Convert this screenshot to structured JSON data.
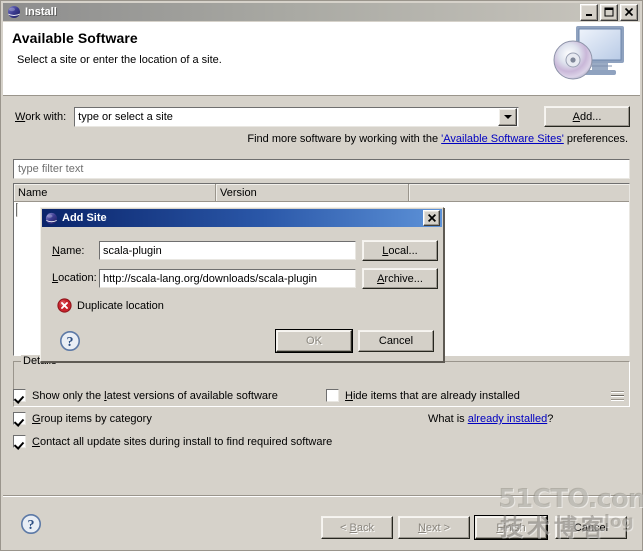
{
  "window": {
    "title": "Install",
    "icon": "eclipse-globe-icon",
    "controls": {
      "minimize": "minimize-icon",
      "maximize": "maximize-icon",
      "close": "close-icon"
    }
  },
  "banner": {
    "title": "Available Software",
    "subtitle": "Select a site or enter the location of a site.",
    "art": "computer-cd-icon"
  },
  "work_with": {
    "label_pre": "W",
    "label_post": "ork with:",
    "combo_value": "type or select a site",
    "dropdown_icon": "chevron-down-icon",
    "add_button": "Add..."
  },
  "hint": {
    "before": "Find more software by working with the ",
    "link": "'Available Software Sites'",
    "after": " preferences."
  },
  "filter": {
    "placeholder": "type filter text"
  },
  "table": {
    "columns": [
      "Name",
      "Version"
    ]
  },
  "details": {
    "label": "Details",
    "resize_grip": "resize-grip-icon"
  },
  "options": [
    {
      "label_pre": "Show only the ",
      "mnemonic": "l",
      "label_post": "atest versions of available software",
      "checked": true
    },
    {
      "label_pre": "",
      "mnemonic": "G",
      "label_post": "roup items by category",
      "checked": true
    },
    {
      "label_pre": "",
      "mnemonic": "C",
      "label_post": "ontact all update sites during install to find required software",
      "checked": true
    },
    {
      "label_pre": "",
      "mnemonic": "H",
      "label_post": "ide items that are already installed",
      "checked": false
    }
  ],
  "what_is": {
    "before": "What is ",
    "link": "already installed",
    "after": "?"
  },
  "footer": {
    "help_icon": "help-question-icon",
    "buttons": [
      {
        "label": "< Back",
        "mnemonic": "B",
        "disabled": true
      },
      {
        "label": "Next >",
        "mnemonic": "N",
        "disabled": true
      },
      {
        "label": "Finish",
        "mnemonic": "F",
        "disabled": true,
        "default": true
      },
      {
        "label": "Cancel",
        "mnemonic": "",
        "disabled": false
      }
    ]
  },
  "dialog": {
    "title": "Add Site",
    "icon": "eclipse-globe-icon",
    "close_icon": "close-icon",
    "name_label_pre": "N",
    "name_label_post": "ame:",
    "name_value": "scala-plugin",
    "location_label_pre": "L",
    "location_label_post": "ocation:",
    "location_value": "http://scala-lang.org/downloads/scala-plugin",
    "local_button": "Local...",
    "archive_button": "Archive...",
    "error_icon": "error-circle-icon",
    "error_text": "Duplicate location",
    "help_icon": "help-question-icon",
    "ok_button": "OK",
    "cancel_button": "Cancel"
  },
  "watermark": {
    "top": "51CTO.com",
    "cn": "技术博客",
    "log": "log"
  },
  "colors": {
    "face": "#d6d2ca",
    "title_active": "#0a246a",
    "link": "#0000c0",
    "error": "#c8232c"
  }
}
